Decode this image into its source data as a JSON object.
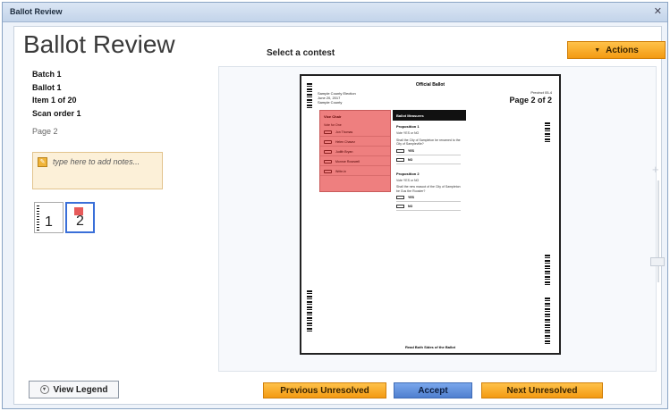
{
  "window": {
    "title": "Ballot Review"
  },
  "header": {
    "page_title": "Ballot Review",
    "select_contest": "Select a contest",
    "actions_label": "Actions"
  },
  "info": {
    "batch": "Batch 1",
    "ballot": "Ballot 1",
    "item": "Item 1 of 20",
    "scan_order": "Scan order 1",
    "page": "Page 2"
  },
  "notes": {
    "placeholder": "type here to add notes..."
  },
  "thumbnails": [
    {
      "label": "1"
    },
    {
      "label": "2"
    }
  ],
  "ballot_image": {
    "header": "Official Ballot",
    "left_meta": [
      "Sample County Election",
      "June 20, 2017",
      "Sample County"
    ],
    "right_meta": "Precinct 05-4",
    "page_label": "Page 2 of 2",
    "contest_title": "Vice Chair",
    "contest_vote_for": "Vote for One",
    "candidates": [
      "Jon Thomas",
      "Helen Chavez",
      "Judith Bryan",
      "Monroe Rosewell",
      "Write-in"
    ],
    "measures_header": "Ballot Measures",
    "proposition_1": {
      "title": "Proposition 1",
      "prompt": "Vote YES or NO",
      "question": "Shall the City of Sampleton be renamed to the City of Sampleville?",
      "options": [
        "YES",
        "NO"
      ]
    },
    "proposition_2": {
      "title": "Proposition 2",
      "prompt": "Vote YES or NO",
      "question": "Shall the new mascot of the City of Sampleton be Gus the Rooster?",
      "options": [
        "YES",
        "NO"
      ]
    },
    "footer": "Read Both Sides of the Ballot"
  },
  "footer": {
    "legend_label": "View Legend",
    "prev_label": "Previous Unresolved",
    "accept_label": "Accept",
    "next_label": "Next Unresolved"
  }
}
